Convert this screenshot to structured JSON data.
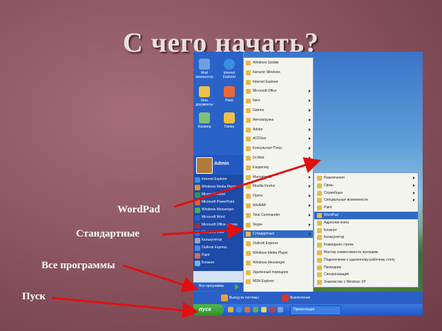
{
  "slide": {
    "title": "С чего начать?",
    "captions": {
      "wordpad": "WordPad",
      "standard": "Стандартные",
      "all_programs": "Все программы",
      "start": "Пуск"
    }
  },
  "colors": {
    "slide_bg": "#8a5560",
    "arrow": "#e01010",
    "menu_blue": "#2a5fc6",
    "selection": "#316ac5",
    "start_green": "#3fa83a"
  },
  "screenshot": {
    "desktop_icons": [
      {
        "label": "Мой компьютер",
        "icon": "computer-icon"
      },
      {
        "label": "Internet Explorer",
        "icon": "ie-icon"
      },
      {
        "label": "Мои документы",
        "icon": "folder-icon"
      },
      {
        "label": "Paint",
        "icon": "paint-icon"
      },
      {
        "label": "Корзина",
        "icon": "recycle-icon"
      },
      {
        "label": "Папка",
        "icon": "folder-icon"
      }
    ],
    "user": {
      "name": "Admin"
    },
    "pinned": [
      {
        "label": "Internet Explorer"
      },
      {
        "label": "Windows Media Player"
      },
      {
        "label": "Microsoft Excel"
      },
      {
        "label": "Microsoft PowerPoint"
      },
      {
        "label": "Windows Messenger"
      },
      {
        "label": "Microsoft Word"
      },
      {
        "label": "Microsoft Office Access"
      },
      {
        "label": "Microsoft Visio"
      },
      {
        "label": "Калькулятор"
      },
      {
        "label": "Outlook Express"
      },
      {
        "label": "Paint"
      },
      {
        "label": "Блокнот"
      },
      {
        "label": "Проводник"
      }
    ],
    "all_programs_label": "Все программы",
    "programs": [
      {
        "label": "Windows Update",
        "arrow": false
      },
      {
        "label": "Каталог Windows",
        "arrow": false
      },
      {
        "label": "Internet Explorer",
        "arrow": false
      },
      {
        "label": "Microsoft Office",
        "arrow": true
      },
      {
        "label": "Nero",
        "arrow": true
      },
      {
        "label": "Games",
        "arrow": true
      },
      {
        "label": "Автозагрузка",
        "arrow": true
      },
      {
        "label": "Adobe",
        "arrow": true
      },
      {
        "label": "ACDSee",
        "arrow": true
      },
      {
        "label": "Консультант Плюс",
        "arrow": true
      },
      {
        "label": "Dr.Web",
        "arrow": true
      },
      {
        "label": "Kaspersky",
        "arrow": true
      },
      {
        "label": "Macromedia",
        "arrow": true
      },
      {
        "label": "Mozilla Firefox",
        "arrow": true
      },
      {
        "label": "Opera",
        "arrow": true
      },
      {
        "label": "WinRAR",
        "arrow": true
      },
      {
        "label": "Total Commander",
        "arrow": true
      },
      {
        "label": "Skype",
        "arrow": true
      },
      {
        "label": "Стандартные",
        "arrow": true,
        "selected": true
      },
      {
        "label": "Outlook Express",
        "arrow": false
      },
      {
        "label": "Windows Media Player",
        "arrow": false
      },
      {
        "label": "Windows Messenger",
        "arrow": false
      },
      {
        "label": "Удаленный помощник",
        "arrow": false
      },
      {
        "label": "MSN Explorer",
        "arrow": false
      }
    ],
    "accessories": [
      {
        "label": "Развлечения",
        "arrow": true
      },
      {
        "label": "Связь",
        "arrow": true
      },
      {
        "label": "Служебные",
        "arrow": true
      },
      {
        "label": "Специальные возможности",
        "arrow": true
      },
      {
        "label": "Paint",
        "arrow": false
      },
      {
        "label": "WordPad",
        "arrow": false,
        "selected": true
      },
      {
        "label": "Адресная книга",
        "arrow": false
      },
      {
        "label": "Блокнот",
        "arrow": false
      },
      {
        "label": "Калькулятор",
        "arrow": false
      },
      {
        "label": "Командная строка",
        "arrow": false
      },
      {
        "label": "Мастер совместимости программ",
        "arrow": false
      },
      {
        "label": "Подключение к удаленному рабочему столу",
        "arrow": false
      },
      {
        "label": "Проводник",
        "arrow": false
      },
      {
        "label": "Синхронизация",
        "arrow": false
      },
      {
        "label": "Знакомство с Windows XP",
        "arrow": false
      }
    ],
    "logoff": "Выход из системы",
    "shutdown": "Выключение",
    "taskbar": {
      "start": "пуск",
      "task_item": "Презентация"
    }
  }
}
